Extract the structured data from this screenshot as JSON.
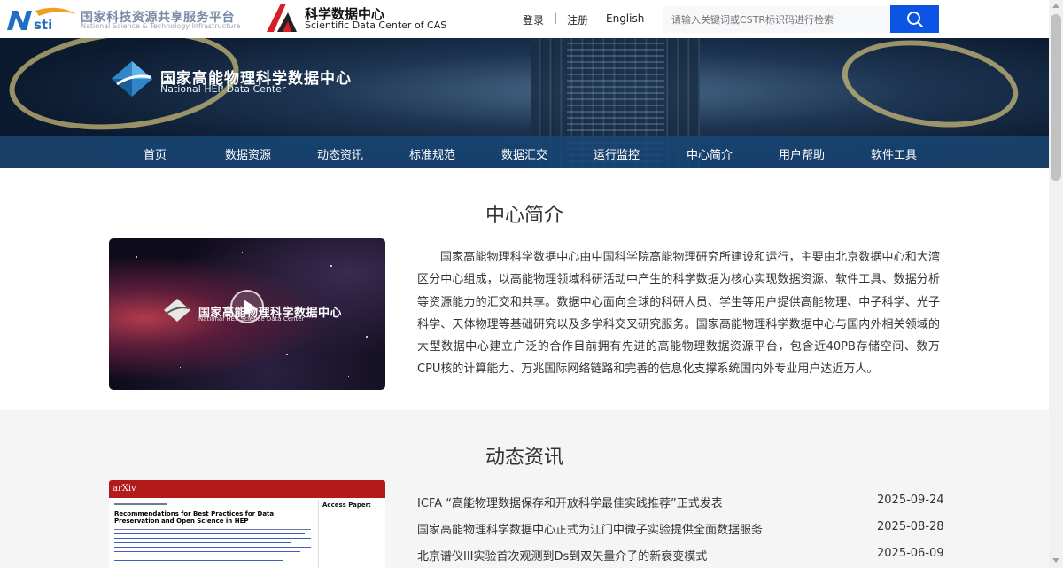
{
  "header": {
    "nsti_cn": "国家科技资源共享服务平台",
    "nsti_en": "National Science & Technology Infrastructure",
    "sdc_cn": "科学数据中心",
    "sdc_en": "Scientific Data Center of CAS",
    "login": "登录",
    "separator": "|",
    "register": "注册",
    "language": "English",
    "search_placeholder": "请输入关键词或CSTR标识码进行检索"
  },
  "banner": {
    "title_cn": "国家高能物理科学数据中心",
    "title_en": "National HEP Data Center"
  },
  "nav": [
    "首页",
    "数据资源",
    "动态资讯",
    "标准规范",
    "数据汇交",
    "运行监控",
    "中心简介",
    "用户帮助",
    "软件工具"
  ],
  "intro": {
    "title": "中心简介",
    "video_title_cn": "国家高能物理科学数据中心",
    "video_title_en": "National HEP Science Data Center",
    "text": "国家高能物理科学数据中心由中国科学院高能物理研究所建设和运行，主要由北京数据中心和大湾区分中心组成，以高能物理领域科研活动中产生的科学数据为核心实现数据资源、软件工具、数据分析等资源能力的汇交和共享。数据中心面向全球的科研人员、学生等用户提供高能物理、中子科学、光子科学、天体物理等基础研究以及多学科交叉研究服务。国家高能物理科学数据中心与国内外相关领域的大型数据中心建立广泛的合作目前拥有先进的高能物理数据资源平台，包含近40PB存储空间、数万CPU核的计算能力、万兆国际网络链路和完善的信息化支撑系统国内外专业用户达近万人。"
  },
  "news": {
    "title": "动态资讯",
    "thumb_logo": "arXiv",
    "thumb_title": "Recommendations for Best Practices for Data Preservation and Open Science in HEP",
    "thumb_side": "Access Paper:",
    "items": [
      {
        "title": "ICFA “高能物理数据保存和开放科学最佳实践推荐”正式发表",
        "date": "2025-09-24"
      },
      {
        "title": "国家高能物理科学数据中心正式为江门中微子实验提供全面数据服务",
        "date": "2025-08-28"
      },
      {
        "title": "北京谱仪III实验首次观测到Ds到双矢量介子的新衰变模式",
        "date": "2025-06-09"
      }
    ]
  },
  "colors": {
    "accent": "#0c55e4",
    "nav_bg": "#1e4e80",
    "section_bg": "#f5f5f5"
  }
}
